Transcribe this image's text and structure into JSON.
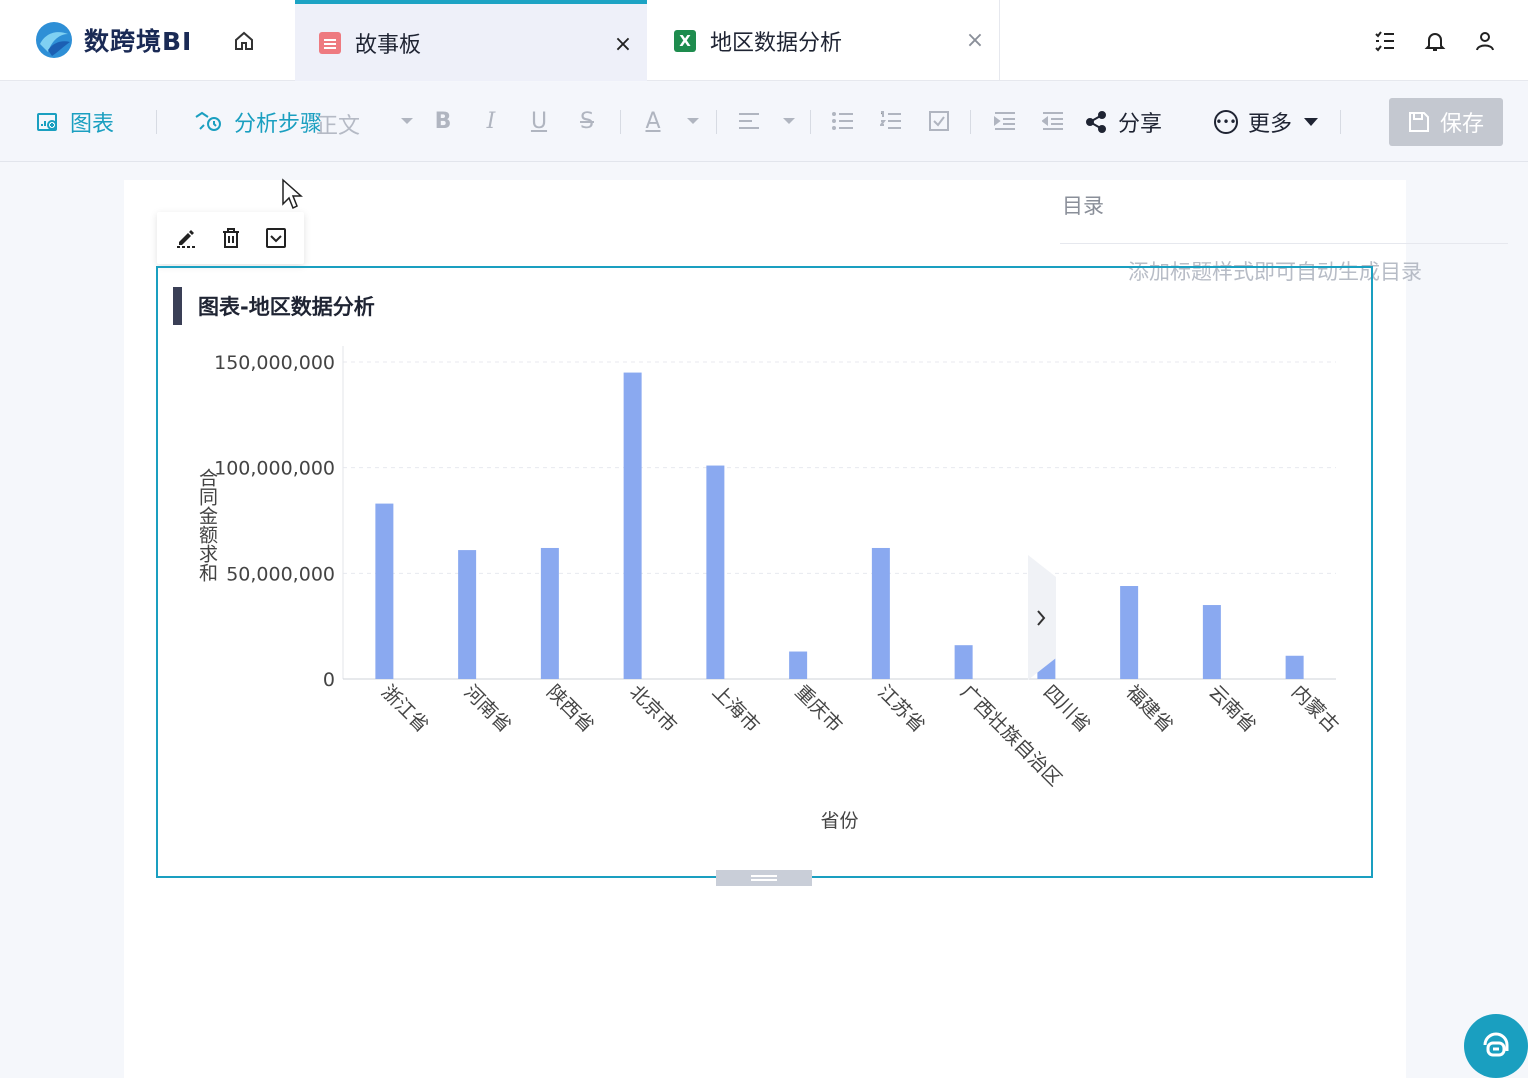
{
  "app": {
    "name": "数跨境BI"
  },
  "tabs": [
    {
      "label": "故事板",
      "close": "×",
      "active": true
    },
    {
      "label": "地区数据分析",
      "close": "×",
      "active": false,
      "icon_text": "X"
    }
  ],
  "toolbar": {
    "chart_label": "图表",
    "steps_label": "分析步骤",
    "text_style_label": "正文",
    "share_label": "分享",
    "more_label": "更多",
    "save_label": "保存",
    "format_glyphs": {
      "bold": "B",
      "italic": "I",
      "underline": "U",
      "strike": "S",
      "font_color": "A"
    }
  },
  "toc": {
    "title": "目录",
    "hint": "添加标题样式即可自动生成目录"
  },
  "chart_card": {
    "title": "图表-地区数据分析"
  },
  "colors": {
    "accent": "#1a9fc0",
    "bar": "#8aa9f0",
    "save_disabled": "#c4c8d0"
  },
  "chart_data": {
    "type": "bar",
    "xlabel": "省份",
    "ylabel": "合同金额求和",
    "ylim": [
      0,
      150000000
    ],
    "yticks": [
      {
        "value": 0,
        "label": "0"
      },
      {
        "value": 50000000,
        "label": "50,000,000"
      },
      {
        "value": 100000000,
        "label": "100,000,000"
      },
      {
        "value": 150000000,
        "label": "150,000,000"
      }
    ],
    "categories": [
      "浙江省",
      "河南省",
      "陕西省",
      "北京市",
      "上海市",
      "重庆市",
      "江苏省",
      "广西壮族自治区",
      "四川省",
      "福建省",
      "云南省",
      "内蒙古"
    ],
    "values": [
      83000000,
      61000000,
      62000000,
      145000000,
      101000000,
      13000000,
      62000000,
      16000000,
      44000000,
      44000000,
      35000000,
      11000000
    ]
  }
}
